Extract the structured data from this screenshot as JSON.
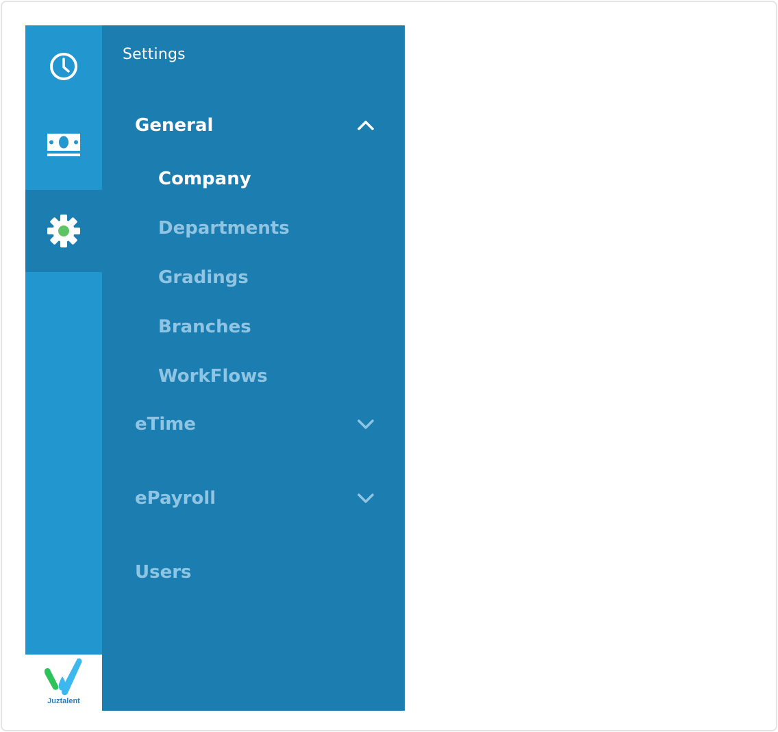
{
  "rail": {
    "items": [
      {
        "icon": "clock-icon",
        "active": false
      },
      {
        "icon": "money-icon",
        "active": false
      },
      {
        "icon": "gear-icon",
        "active": true
      }
    ],
    "logo_text": "Juztalent",
    "active_dot_color": "#5cc462"
  },
  "panel": {
    "title": "Settings",
    "sections": [
      {
        "label": "General",
        "expanded": true,
        "items": [
          "Company",
          "Departments",
          "Gradings",
          "Branches",
          "WorkFlows"
        ],
        "active_item": "Company"
      },
      {
        "label": "eTime",
        "expanded": false
      },
      {
        "label": "ePayroll",
        "expanded": false
      },
      {
        "label": "Users"
      }
    ]
  },
  "colors": {
    "rail_bg": "#2196cf",
    "panel_bg": "#1c7eb0",
    "active_text": "#ffffff",
    "inactive_text": "#8fc5e3"
  }
}
